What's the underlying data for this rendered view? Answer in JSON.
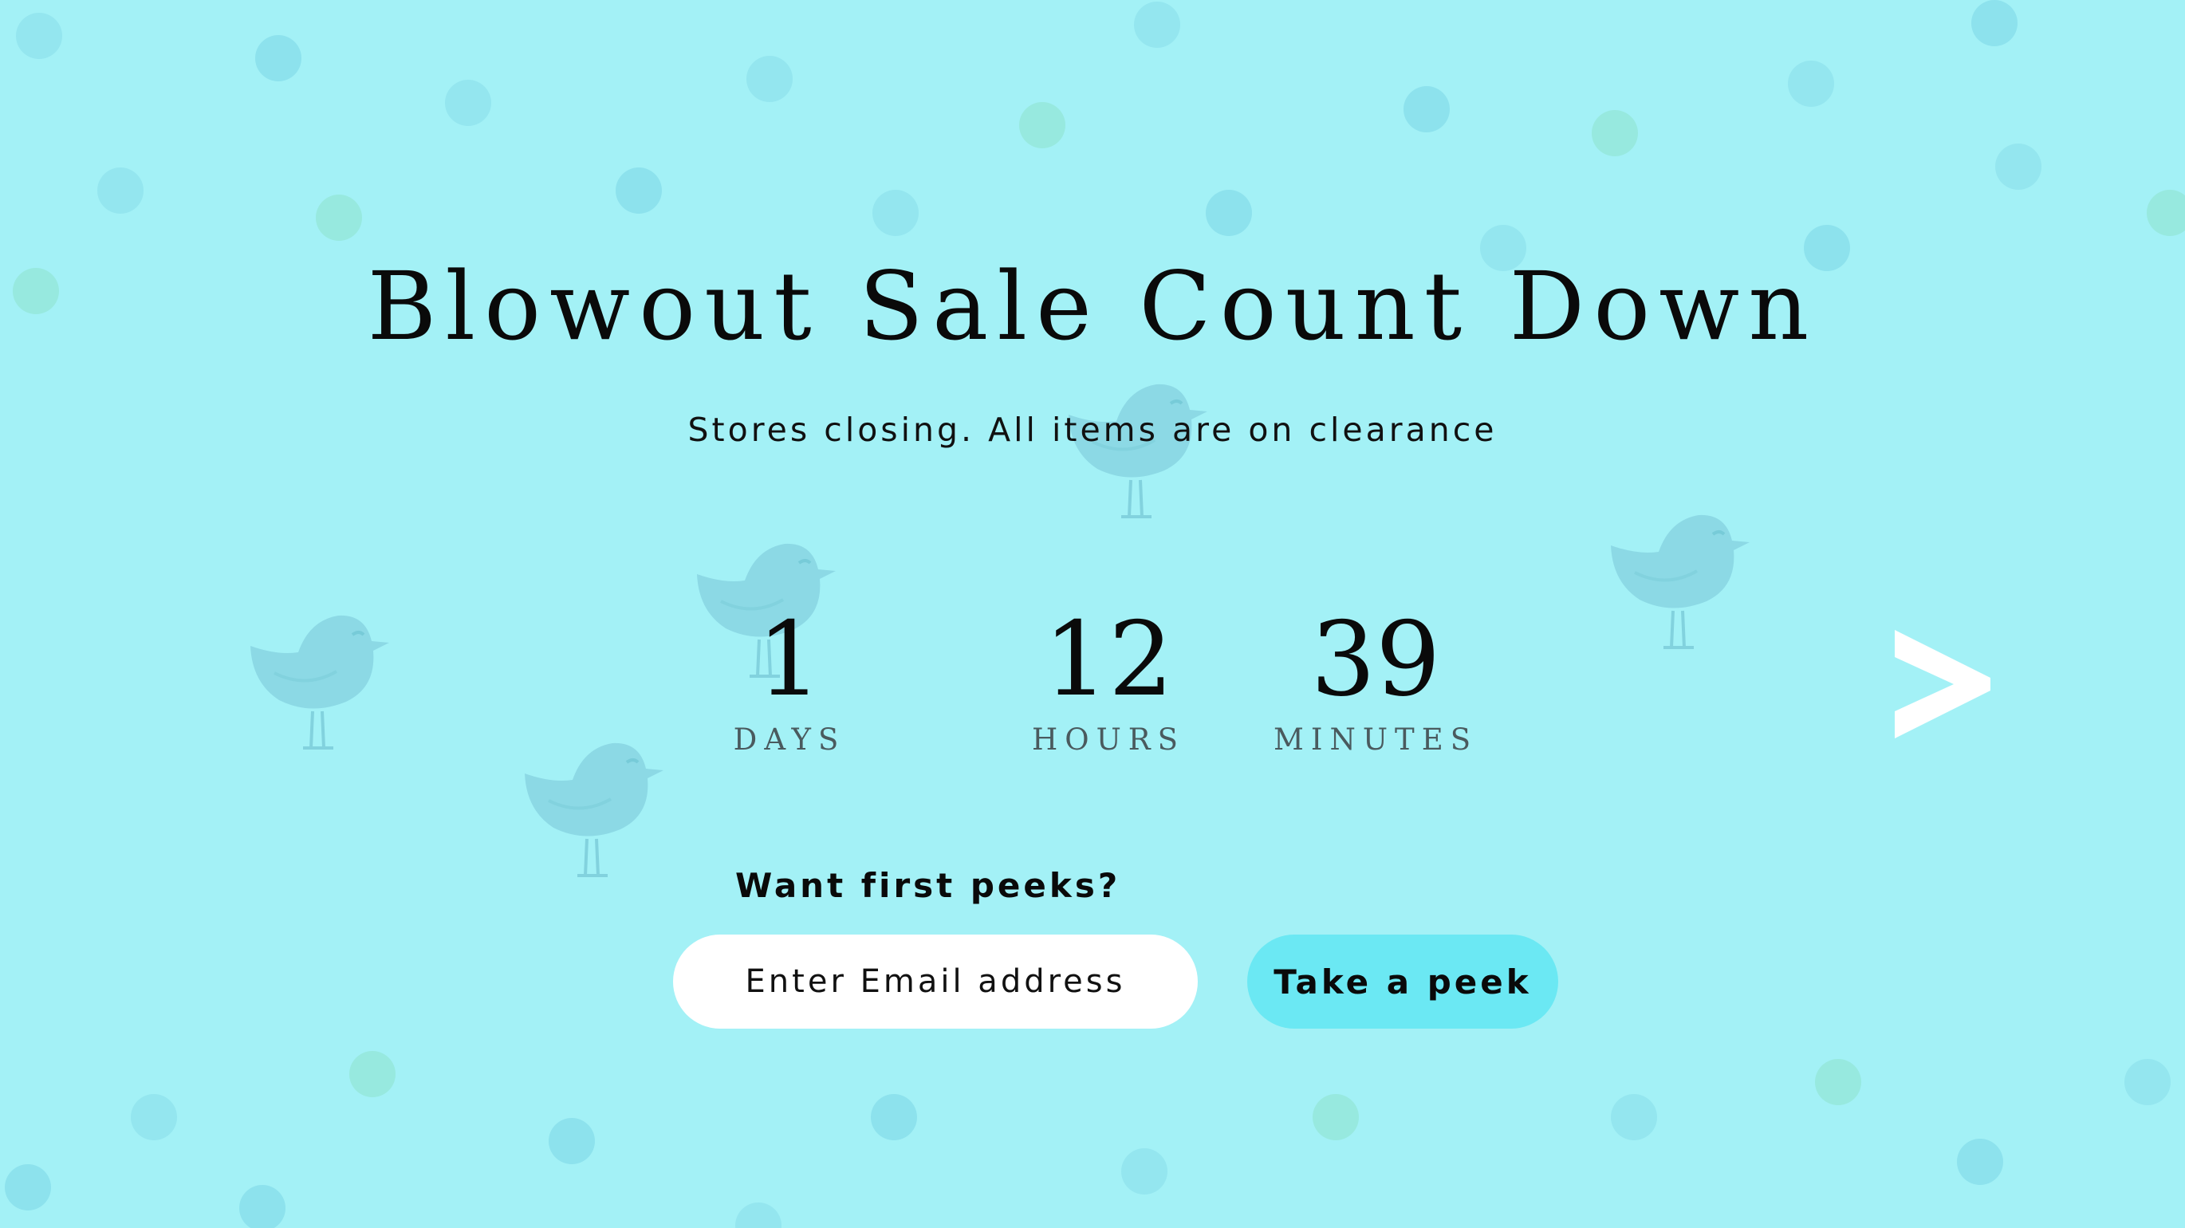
{
  "header": {
    "title": "Blowout Sale Count Down",
    "subtitle": "Stores closing. All items are on clearance"
  },
  "countdown": {
    "days": {
      "value": "1",
      "label": "DAYS"
    },
    "hours": {
      "value": "12",
      "label": "HOURS"
    },
    "minutes": {
      "value": "39",
      "label": "MINUTES"
    }
  },
  "signup": {
    "prompt": "Want first peeks?",
    "email_placeholder": "Enter Email address",
    "button_label": "Take a peek"
  },
  "navigation": {
    "next_icon": "chevron-right-icon"
  },
  "colors": {
    "background": "#a3f1f6",
    "button": "#6be8f3",
    "input": "#ffffff",
    "text": "#0a0a0a"
  }
}
